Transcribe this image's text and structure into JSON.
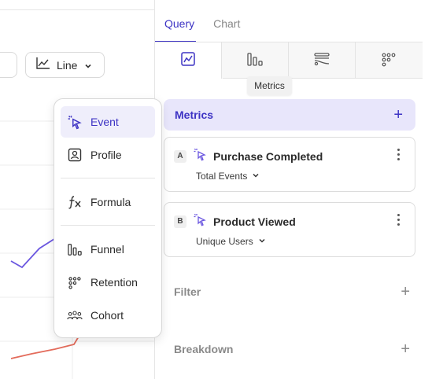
{
  "toolbar": {
    "chart_type_label": "Line"
  },
  "tabs": [
    {
      "label": "Query",
      "active": true
    },
    {
      "label": "Chart",
      "active": false
    }
  ],
  "viz_buttons": [
    {
      "icon": "line-chart-icon",
      "active": true
    },
    {
      "icon": "funnel-bars-icon",
      "active": false
    },
    {
      "icon": "flows-icon",
      "active": false
    },
    {
      "icon": "retention-dots-icon",
      "active": false
    }
  ],
  "tooltip": "Metrics",
  "metrics": {
    "title": "Metrics",
    "add_symbol": "+",
    "items": [
      {
        "badge": "A",
        "name": "Purchase Completed",
        "aggregation": "Total Events"
      },
      {
        "badge": "B",
        "name": "Product Viewed",
        "aggregation": "Unique Users"
      }
    ]
  },
  "filter": {
    "title": "Filter",
    "add_symbol": "+"
  },
  "breakdown": {
    "title": "Breakdown",
    "add_symbol": "+"
  },
  "menu": {
    "items": [
      {
        "label": "Event",
        "icon": "event-cursor-icon",
        "highlighted": true
      },
      {
        "label": "Profile",
        "icon": "profile-card-icon",
        "highlighted": false
      },
      {
        "label": "Formula",
        "icon": "formula-fx-icon",
        "highlighted": false
      },
      {
        "label": "Funnel",
        "icon": "funnel-bars-icon",
        "highlighted": false
      },
      {
        "label": "Retention",
        "icon": "retention-dots-icon",
        "highlighted": false
      },
      {
        "label": "Cohort",
        "icon": "cohort-people-icon",
        "highlighted": false
      }
    ]
  },
  "colors": {
    "accent": "#3d33c4",
    "series_purple": "#6b57e0",
    "series_red": "#e36b5b",
    "menu_highlight": "#efeefb",
    "metrics_header": "#e8e6fb"
  }
}
